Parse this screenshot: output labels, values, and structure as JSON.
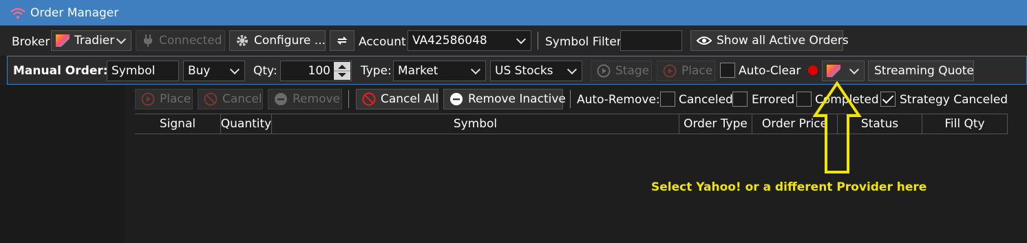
{
  "window": {
    "title": "Order Manager"
  },
  "toolbar": {
    "broker_label": "Broker",
    "broker_value": "Tradier",
    "connected_label": "Connected",
    "configure_label": "Configure ...",
    "account_label": "Account",
    "account_value": "VA42586048",
    "symbol_filter_label": "Symbol Filter",
    "symbol_filter_value": "",
    "show_all_label": "Show all Active Orders"
  },
  "manual_order": {
    "label": "Manual Order:",
    "symbol_value": "Symbol",
    "side_value": "Buy",
    "qty_label": "Qty:",
    "qty_value": "100",
    "type_label": "Type:",
    "type_value": "Market",
    "market_value": "US Stocks",
    "stage_label": "Stage",
    "place_label": "Place",
    "auto_clear_label": "Auto-Clear",
    "streaming_quote_label": "Streaming Quote"
  },
  "orders_toolbar": {
    "place_label": "Place",
    "cancel_label": "Cancel",
    "remove_label": "Remove",
    "cancel_all_label": "Cancel All",
    "remove_inactive_label": "Remove Inactive",
    "auto_remove_label": "Auto-Remove:",
    "canceled_label": "Canceled",
    "errored_label": "Errored",
    "completed_label": "Completed",
    "strategy_canceled_label": "Strategy Canceled"
  },
  "grid": {
    "columns": [
      "Signal",
      "Quantity",
      "Symbol",
      "Order Type",
      "Order Price",
      "Status",
      "Fill Qty"
    ]
  },
  "annotation": {
    "text": "Select Yahoo! or a different Provider here",
    "color": "#f2e600"
  },
  "colors": {
    "titlebar": "#3f7fbf",
    "record_dot": "#e00000"
  }
}
